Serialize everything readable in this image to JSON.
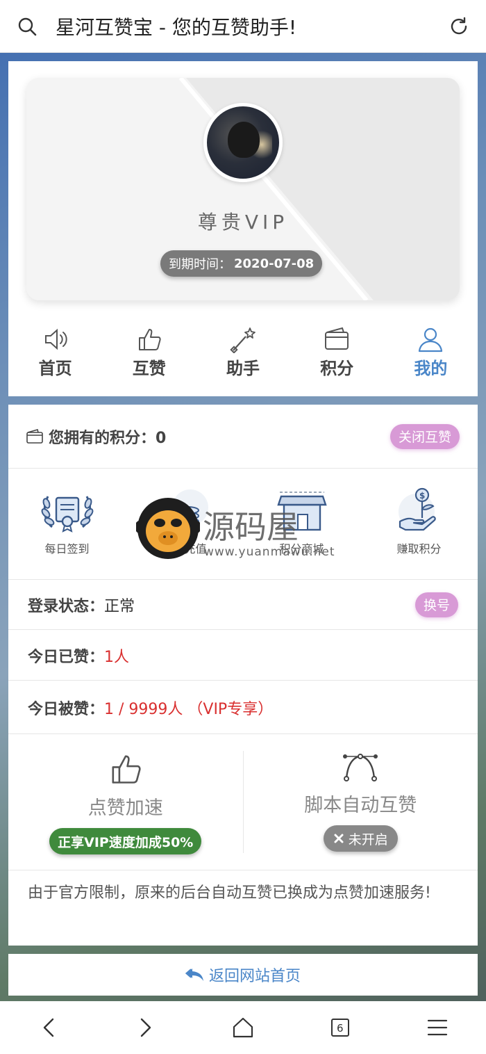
{
  "topbar": {
    "title": "星河互赞宝 - 您的互赞助手!"
  },
  "profile": {
    "level": "尊贵VIP",
    "expire_label": "到期时间：",
    "expire_date": "2020-07-08"
  },
  "nav": [
    {
      "label": "首页",
      "icon": "speaker-icon",
      "active": false
    },
    {
      "label": "互赞",
      "icon": "thumbs-up-icon",
      "active": false
    },
    {
      "label": "助手",
      "icon": "magic-wand-icon",
      "active": false
    },
    {
      "label": "积分",
      "icon": "wallet-icon",
      "active": false
    },
    {
      "label": "我的",
      "icon": "user-icon",
      "active": true
    }
  ],
  "points": {
    "label": "您拥有的积分：0",
    "close_button": "关闭互赞"
  },
  "features": [
    {
      "label": "每日签到",
      "icon": "laurel-certificate-icon"
    },
    {
      "label": "积分充值",
      "icon": "coin-stack-icon"
    },
    {
      "label": "积分商城",
      "icon": "shop-icon"
    },
    {
      "label": "赚取积分",
      "icon": "money-plant-hand-icon"
    }
  ],
  "status": {
    "login_key": "登录状态：",
    "login_value": "正常",
    "switch_button": "换号"
  },
  "today_liked": {
    "key": "今日已赞：",
    "value": "1人"
  },
  "today_received": {
    "key": "今日被赞：",
    "value": "1 / 9999人 （VIP专享）"
  },
  "speedup": {
    "title": "点赞加速",
    "badge": "正享VIP速度加成50%"
  },
  "script": {
    "title": "脚本自动互赞",
    "badge": "未开启"
  },
  "note": "由于官方限制，原来的后台自动互赞已换成为点赞加速服务!",
  "back_link": "返回网站首页",
  "watermark": {
    "text": "源码屋",
    "url": "www.yuanmawu.net"
  },
  "bottom_tabs": {
    "tab_count": "6"
  },
  "colors": {
    "accent": "#4a86c8",
    "pink": "#d89ad6",
    "green": "#3f8a3c",
    "red": "#d93030"
  }
}
